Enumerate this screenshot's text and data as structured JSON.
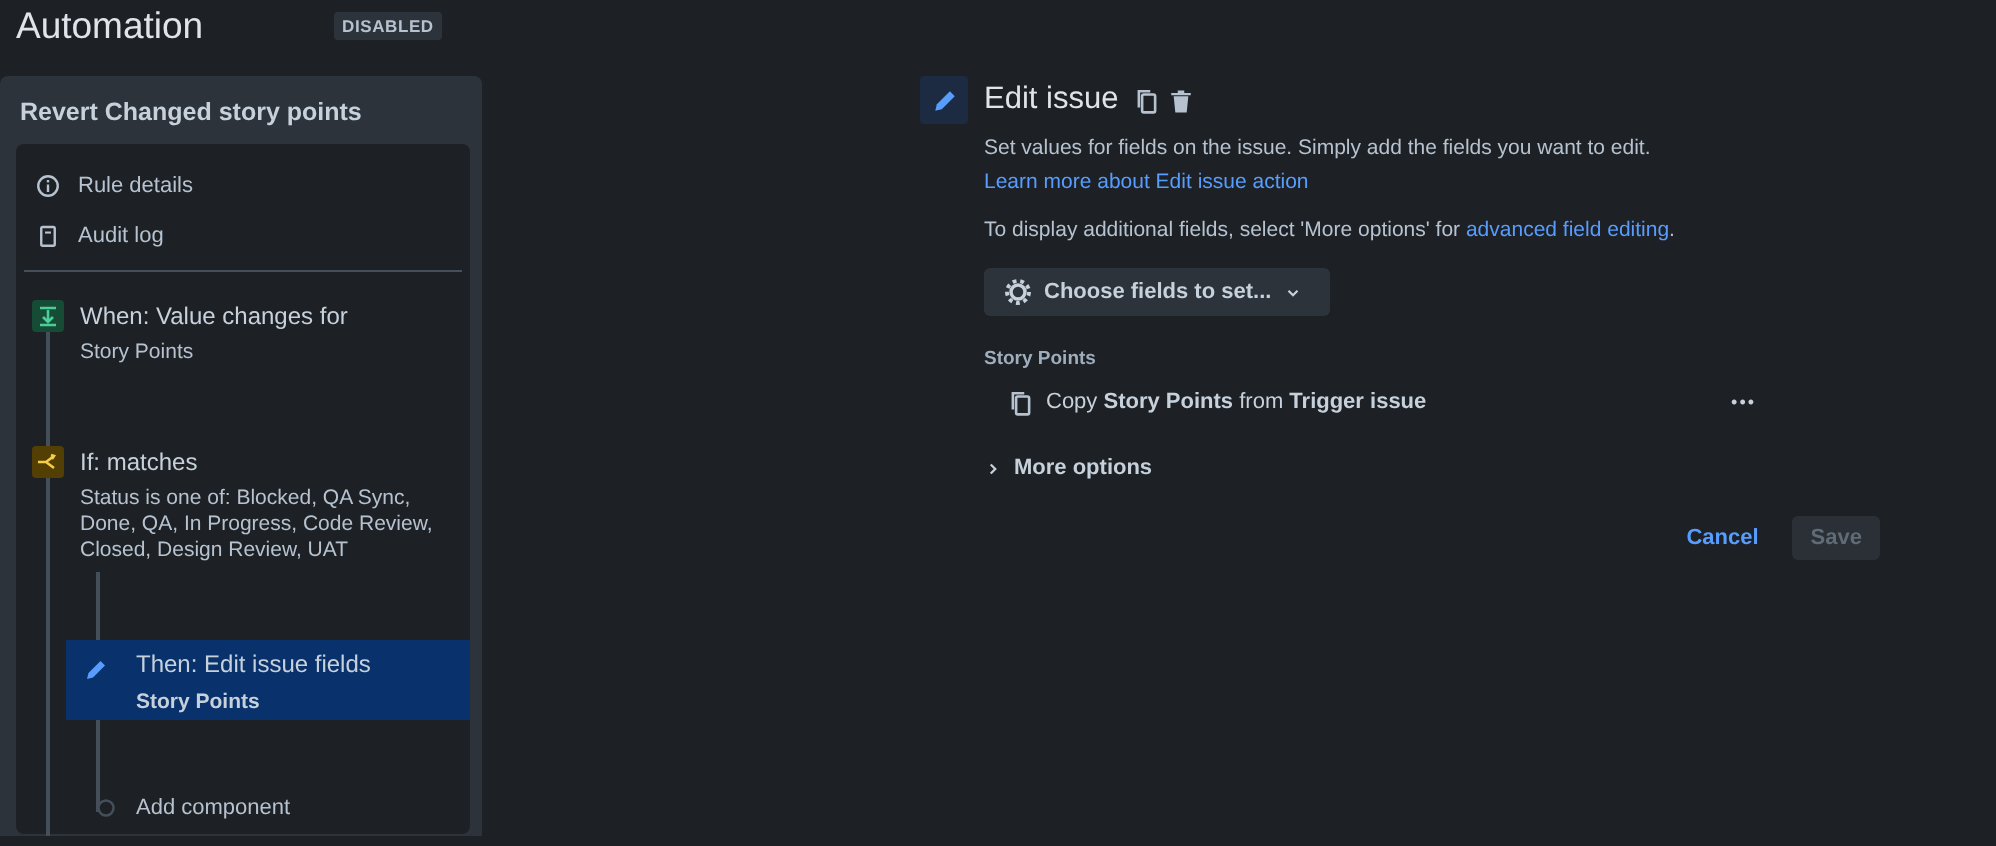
{
  "header": {
    "title": "Automation",
    "status_badge": "DISABLED"
  },
  "rule": {
    "name": "Revert Changed story points",
    "menu": [
      {
        "kind": "info",
        "label": "Rule details"
      },
      {
        "kind": "log",
        "label": "Audit log"
      }
    ],
    "steps": [
      {
        "kind": "trigger",
        "title": "When: Value changes for",
        "detail": "Story Points",
        "selected": false
      },
      {
        "kind": "condition",
        "title": "If: matches",
        "detail": "Status is one of: Blocked, QA Sync, Done, QA, In Progress, Code Review, Closed, Design Review, UAT",
        "selected": false,
        "children": [
          {
            "kind": "action",
            "title": "Then: Edit issue fields",
            "detail": "Story Points",
            "selected": true
          },
          {
            "kind": "add",
            "title": "Add component",
            "selected": false
          }
        ]
      }
    ]
  },
  "editor": {
    "title": "Edit issue",
    "paragraphs": [
      [
        {
          "text": "Set values for fields on the issue. Simply add the fields you want to edit. "
        },
        {
          "link": "Learn more about Edit issue action"
        }
      ],
      [
        {
          "text": "To display additional fields, select 'More options' for "
        },
        {
          "link": "advanced field editing"
        },
        {
          "text": "."
        }
      ]
    ],
    "choose_button": "Choose fields to set...",
    "fields": [
      {
        "label": "Story Points",
        "value": "Copy **Story Points** from **Trigger issue**",
        "menu": "•••"
      }
    ],
    "more_options": {
      "label": "More options",
      "expanded": false
    },
    "buttons": [
      {
        "kind": "link",
        "label": "Cancel",
        "disabled": false
      },
      {
        "kind": "primary",
        "label": "Save",
        "disabled": true
      }
    ]
  }
}
